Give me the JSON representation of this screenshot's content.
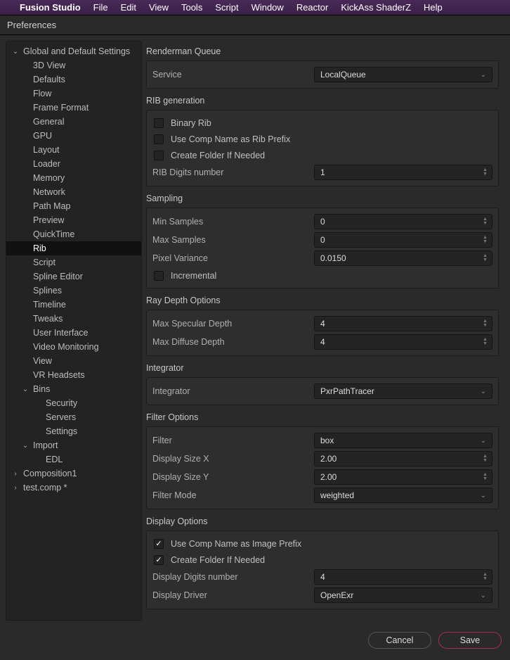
{
  "menubar": {
    "app": "Fusion Studio",
    "items": [
      "File",
      "Edit",
      "View",
      "Tools",
      "Script",
      "Window",
      "Reactor",
      "KickAss ShaderZ",
      "Help"
    ]
  },
  "window_title": "Preferences",
  "tree": [
    {
      "label": "Global and Default Settings",
      "level": 0,
      "expander": "down",
      "selected": false,
      "name": "tree-global"
    },
    {
      "label": "3D View",
      "level": 1,
      "selected": false,
      "name": "tree-3d-view"
    },
    {
      "label": "Defaults",
      "level": 1,
      "selected": false,
      "name": "tree-defaults"
    },
    {
      "label": "Flow",
      "level": 1,
      "selected": false,
      "name": "tree-flow"
    },
    {
      "label": "Frame Format",
      "level": 1,
      "selected": false,
      "name": "tree-frame-format"
    },
    {
      "label": "General",
      "level": 1,
      "selected": false,
      "name": "tree-general"
    },
    {
      "label": "GPU",
      "level": 1,
      "selected": false,
      "name": "tree-gpu"
    },
    {
      "label": "Layout",
      "level": 1,
      "selected": false,
      "name": "tree-layout"
    },
    {
      "label": "Loader",
      "level": 1,
      "selected": false,
      "name": "tree-loader"
    },
    {
      "label": "Memory",
      "level": 1,
      "selected": false,
      "name": "tree-memory"
    },
    {
      "label": "Network",
      "level": 1,
      "selected": false,
      "name": "tree-network"
    },
    {
      "label": "Path Map",
      "level": 1,
      "selected": false,
      "name": "tree-path-map"
    },
    {
      "label": "Preview",
      "level": 1,
      "selected": false,
      "name": "tree-preview"
    },
    {
      "label": "QuickTime",
      "level": 1,
      "selected": false,
      "name": "tree-quicktime"
    },
    {
      "label": "Rib",
      "level": 1,
      "selected": true,
      "name": "tree-rib"
    },
    {
      "label": "Script",
      "level": 1,
      "selected": false,
      "name": "tree-script"
    },
    {
      "label": "Spline Editor",
      "level": 1,
      "selected": false,
      "name": "tree-spline-editor"
    },
    {
      "label": "Splines",
      "level": 1,
      "selected": false,
      "name": "tree-splines"
    },
    {
      "label": "Timeline",
      "level": 1,
      "selected": false,
      "name": "tree-timeline"
    },
    {
      "label": "Tweaks",
      "level": 1,
      "selected": false,
      "name": "tree-tweaks"
    },
    {
      "label": "User Interface",
      "level": 1,
      "selected": false,
      "name": "tree-user-interface"
    },
    {
      "label": "Video Monitoring",
      "level": 1,
      "selected": false,
      "name": "tree-video-monitoring"
    },
    {
      "label": "View",
      "level": 1,
      "selected": false,
      "name": "tree-view"
    },
    {
      "label": "VR Headsets",
      "level": 1,
      "selected": false,
      "name": "tree-vr-headsets"
    },
    {
      "label": "Bins",
      "level": 1,
      "expander": "down",
      "selected": false,
      "name": "tree-bins",
      "indentExpander": true
    },
    {
      "label": "Security",
      "level": 2,
      "selected": false,
      "name": "tree-security"
    },
    {
      "label": "Servers",
      "level": 2,
      "selected": false,
      "name": "tree-servers"
    },
    {
      "label": "Settings",
      "level": 2,
      "selected": false,
      "name": "tree-settings"
    },
    {
      "label": "Import",
      "level": 1,
      "expander": "down",
      "selected": false,
      "name": "tree-import",
      "indentExpander": true
    },
    {
      "label": "EDL",
      "level": 2,
      "selected": false,
      "name": "tree-edl"
    },
    {
      "label": "Composition1",
      "level": 0,
      "expander": "right",
      "selected": false,
      "name": "tree-composition1"
    },
    {
      "label": "test.comp *",
      "level": 0,
      "expander": "right",
      "selected": false,
      "name": "tree-testcomp"
    }
  ],
  "sections": {
    "renderman": {
      "title": "Renderman Queue",
      "service_label": "Service",
      "service_value": "LocalQueue"
    },
    "ribgen": {
      "title": "RIB generation",
      "binary": "Binary Rib",
      "compname": "Use Comp Name as Rib Prefix",
      "createfolder": "Create Folder If Needed",
      "digits_label": "RIB Digits number",
      "digits_value": "1"
    },
    "sampling": {
      "title": "Sampling",
      "minsamples_label": "Min Samples",
      "minsamples_value": "0",
      "maxsamples_label": "Max Samples",
      "maxsamples_value": "0",
      "pixelvar_label": "Pixel Variance",
      "pixelvar_value": "0.0150",
      "incremental": "Incremental"
    },
    "raydepth": {
      "title": "Ray Depth Options",
      "maxspec_label": "Max Specular Depth",
      "maxspec_value": "4",
      "maxdiff_label": "Max Diffuse Depth",
      "maxdiff_value": "4"
    },
    "integrator": {
      "title": "Integrator",
      "label": "Integrator",
      "value": "PxrPathTracer"
    },
    "filter": {
      "title": "Filter Options",
      "filter_label": "Filter",
      "filter_value": "box",
      "sizex_label": "Display Size X",
      "sizex_value": "2.00",
      "sizey_label": "Display Size Y",
      "sizey_value": "2.00",
      "mode_label": "Filter Mode",
      "mode_value": "weighted"
    },
    "display": {
      "title": "Display Options",
      "compname": "Use Comp Name as Image Prefix",
      "createfolder": "Create Folder If Needed",
      "digits_label": "Display Digits number",
      "digits_value": "4",
      "driver_label": "Display Driver",
      "driver_value": "OpenExr"
    }
  },
  "footer": {
    "cancel": "Cancel",
    "save": "Save"
  }
}
